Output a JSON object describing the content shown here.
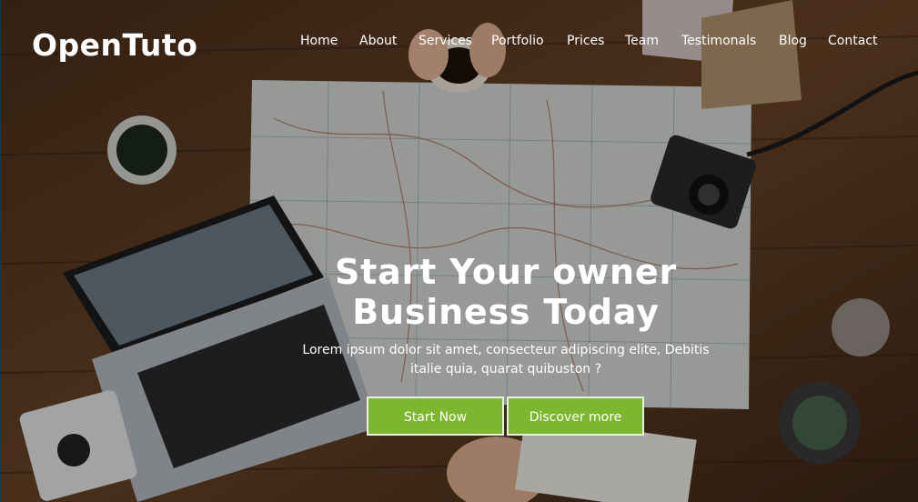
{
  "brand": {
    "name": "OpenTuto"
  },
  "nav": {
    "items": [
      "Home",
      "About",
      "Services",
      "Portfolio",
      "Prices",
      "Team",
      "Testimonals",
      "Blog",
      "Contact"
    ]
  },
  "hero": {
    "headline_line1": "Start Your owner",
    "headline_line2": "Business Today",
    "subtext_line1": "Lorem ipsum dolor sit amet, consecteur adipiscing elite, Debitis",
    "subtext_line2": "italie quia, quarat quibuston ?",
    "primary_button": "Start Now",
    "secondary_button": "Discover more"
  },
  "colors": {
    "accent": "#7cb82f",
    "text": "#ffffff",
    "background_wood": "#5b3b22"
  }
}
